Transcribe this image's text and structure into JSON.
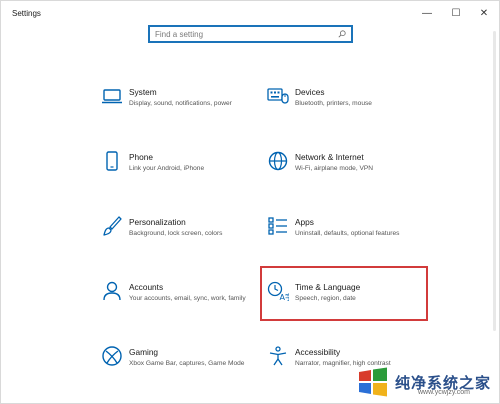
{
  "window": {
    "title": "Settings",
    "controls": {
      "minimize": "—",
      "maximize": "☐",
      "close": "✕"
    }
  },
  "search": {
    "placeholder": "Find a setting",
    "value": ""
  },
  "accent_color": "#0063b1",
  "highlight_color": "#d23b3b",
  "tiles": [
    {
      "title": "System",
      "description": "Display, sound, notifications, power",
      "icon": "laptop-icon"
    },
    {
      "title": "Devices",
      "description": "Bluetooth, printers, mouse",
      "icon": "keyboard-icon"
    },
    {
      "title": "Phone",
      "description": "Link your Android, iPhone",
      "icon": "phone-icon"
    },
    {
      "title": "Network & Internet",
      "description": "Wi-Fi, airplane mode, VPN",
      "icon": "globe-icon"
    },
    {
      "title": "Personalization",
      "description": "Background, lock screen, colors",
      "icon": "brush-icon"
    },
    {
      "title": "Apps",
      "description": "Uninstall, defaults, optional features",
      "icon": "apps-list-icon"
    },
    {
      "title": "Accounts",
      "description": "Your accounts, email, sync, work, family",
      "icon": "person-icon"
    },
    {
      "title": "Time & Language",
      "description": "Speech, region, date",
      "icon": "time-language-icon"
    },
    {
      "title": "Gaming",
      "description": "Xbox Game Bar, captures, Game Mode",
      "icon": "xbox-icon"
    },
    {
      "title": "Accessibility",
      "description": "Narrator, magnifier, high contrast",
      "icon": "accessibility-icon"
    }
  ],
  "watermark": {
    "text": "纯净系统之家",
    "url": "www.ycwjzy.com"
  }
}
